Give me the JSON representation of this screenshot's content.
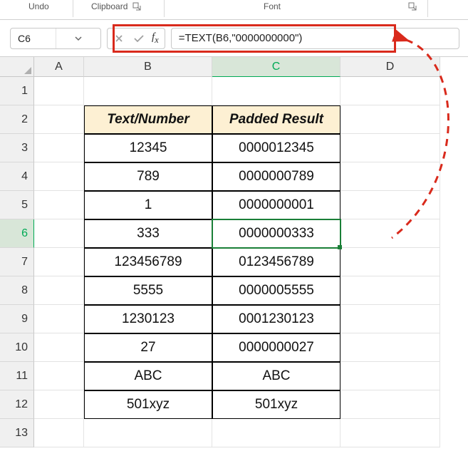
{
  "ribbon": {
    "undo": "Undo",
    "clipboard": "Clipboard",
    "font": "Font"
  },
  "nameBox": "C6",
  "formula": "=TEXT(B6,\"0000000000\")",
  "columns": [
    "A",
    "B",
    "C",
    "D"
  ],
  "rows": [
    "1",
    "2",
    "3",
    "4",
    "5",
    "6",
    "7",
    "8",
    "9",
    "10",
    "11",
    "12",
    "13"
  ],
  "activeCell": {
    "col": "C",
    "row": "6"
  },
  "table": {
    "headers": {
      "b": "Text/Number",
      "c": "Padded Result"
    },
    "data": [
      {
        "b": "12345",
        "c": "0000012345"
      },
      {
        "b": "789",
        "c": "0000000789"
      },
      {
        "b": "1",
        "c": "0000000001"
      },
      {
        "b": "333",
        "c": "0000000333"
      },
      {
        "b": "123456789",
        "c": "0123456789"
      },
      {
        "b": "5555",
        "c": "0000005555"
      },
      {
        "b": "1230123",
        "c": "0001230123"
      },
      {
        "b": "27",
        "c": "0000000027"
      },
      {
        "b": "ABC",
        "c": "ABC"
      },
      {
        "b": "501xyz",
        "c": "501xyz"
      }
    ]
  }
}
